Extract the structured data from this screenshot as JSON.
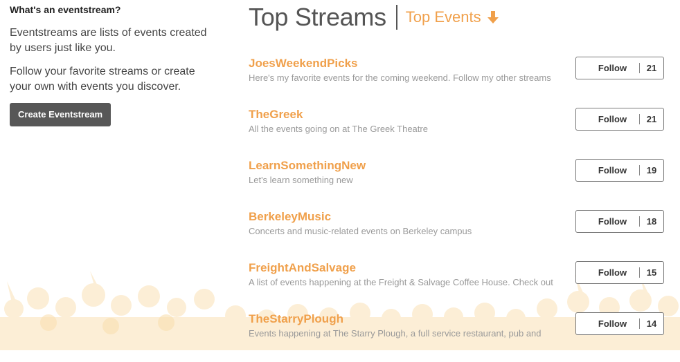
{
  "sidebar": {
    "heading": "What's an eventstream?",
    "para1": "Eventstreams are lists of events created by users just like you.",
    "para2": "Follow your favorite streams or create your own with events you discover.",
    "create_button": "Create Eventstream"
  },
  "main": {
    "title": "Top Streams",
    "subtitle": "Top Events",
    "subtitle_icon": "arrow-down-icon"
  },
  "follow_label": "Follow",
  "streams": [
    {
      "name": "JoesWeekendPicks",
      "desc": "Here's my favorite events for the coming weekend. Follow my other streams",
      "count": "21"
    },
    {
      "name": "TheGreek",
      "desc": "All the events going on at The Greek Theatre",
      "count": "21"
    },
    {
      "name": "LearnSomethingNew",
      "desc": "Let's learn something new",
      "count": "19"
    },
    {
      "name": "BerkeleyMusic",
      "desc": "Concerts and music-related events on Berkeley campus",
      "count": "18"
    },
    {
      "name": "FreightAndSalvage",
      "desc": "A list of events happening at the Freight & Salvage Coffee House. Check out",
      "count": "15"
    },
    {
      "name": "TheStarryPlough",
      "desc": "Events happening at The Starry Plough, a full service restaurant, pub and",
      "count": "14"
    }
  ],
  "colors": {
    "accent": "#f0a04b",
    "button_dark": "#575757",
    "crowd": "#fbe8c4"
  }
}
